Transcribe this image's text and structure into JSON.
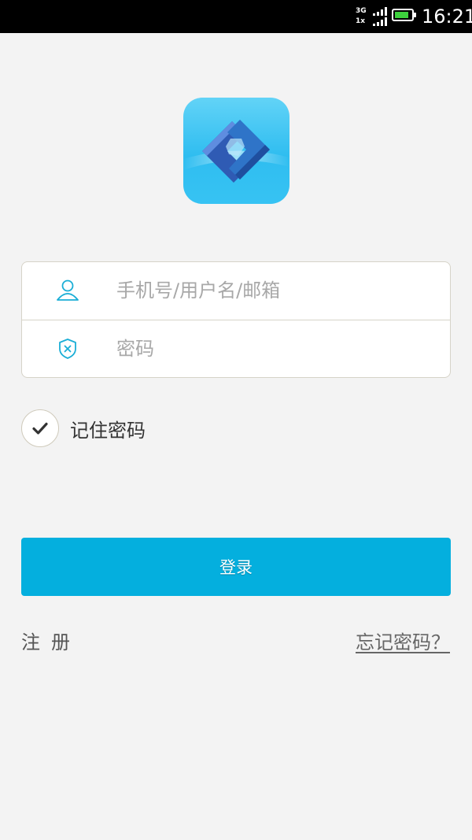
{
  "status_bar": {
    "network_top": "3G",
    "network_bottom": "1x",
    "time": "16:21",
    "battery_level": 0.85,
    "battery_color": "#3dd13d"
  },
  "logo": {
    "icon": "app-logo-icon"
  },
  "login_form": {
    "username": {
      "icon": "user-icon",
      "value": "",
      "placeholder": "手机号/用户名/邮箱"
    },
    "password": {
      "icon": "shield-icon",
      "value": "",
      "placeholder": "密码"
    }
  },
  "remember": {
    "label": "记住密码",
    "checked": true,
    "icon": "check-icon"
  },
  "login_button": {
    "label": "登录",
    "color": "#04afde"
  },
  "links": {
    "register": "注册",
    "forgot": "忘记密码？"
  },
  "colors": {
    "accent": "#04afde",
    "icon": "#1aaed6",
    "background": "#f3f3f3"
  }
}
